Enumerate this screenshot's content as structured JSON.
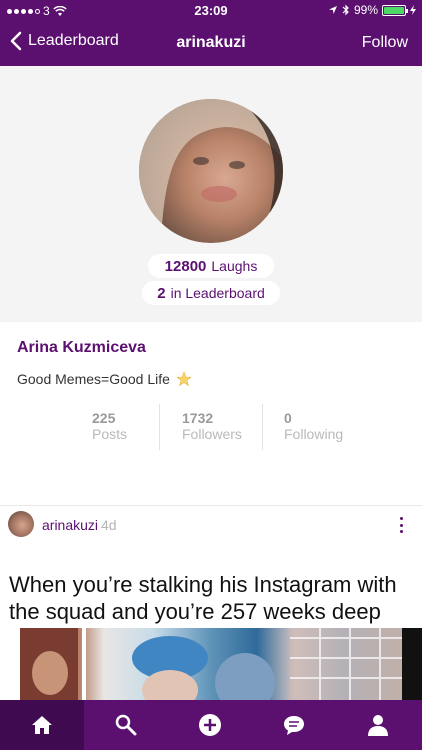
{
  "status_bar": {
    "carrier": "3",
    "time": "23:09",
    "battery": "99%",
    "battery_level": 0.99
  },
  "nav": {
    "back_label": "Leaderboard",
    "title": "arinakuzi",
    "follow_label": "Follow"
  },
  "profile": {
    "laughs_count": "12800",
    "laughs_label": "Laughs",
    "rank": "2",
    "rank_label": "in Leaderboard",
    "name": "Arina Kuzmiceva",
    "bio": "Good Memes=Good Life"
  },
  "stats": [
    {
      "value": "225",
      "label": "Posts"
    },
    {
      "value": "1732",
      "label": "Followers"
    },
    {
      "value": "0",
      "label": "Following"
    }
  ],
  "post": {
    "username": "arinakuzi",
    "time": "4d",
    "caption": "When you’re stalking his Instagram with the squad and you’re 257 weeks deep"
  },
  "tabbar": {
    "items": [
      "home-icon",
      "search-icon",
      "add-icon",
      "chat-icon",
      "profile-icon"
    ],
    "active_index": 0
  },
  "colors": {
    "brand_purple": "#5b1070",
    "active_tab": "#3f0a4f",
    "battery_green": "#4cd964"
  }
}
